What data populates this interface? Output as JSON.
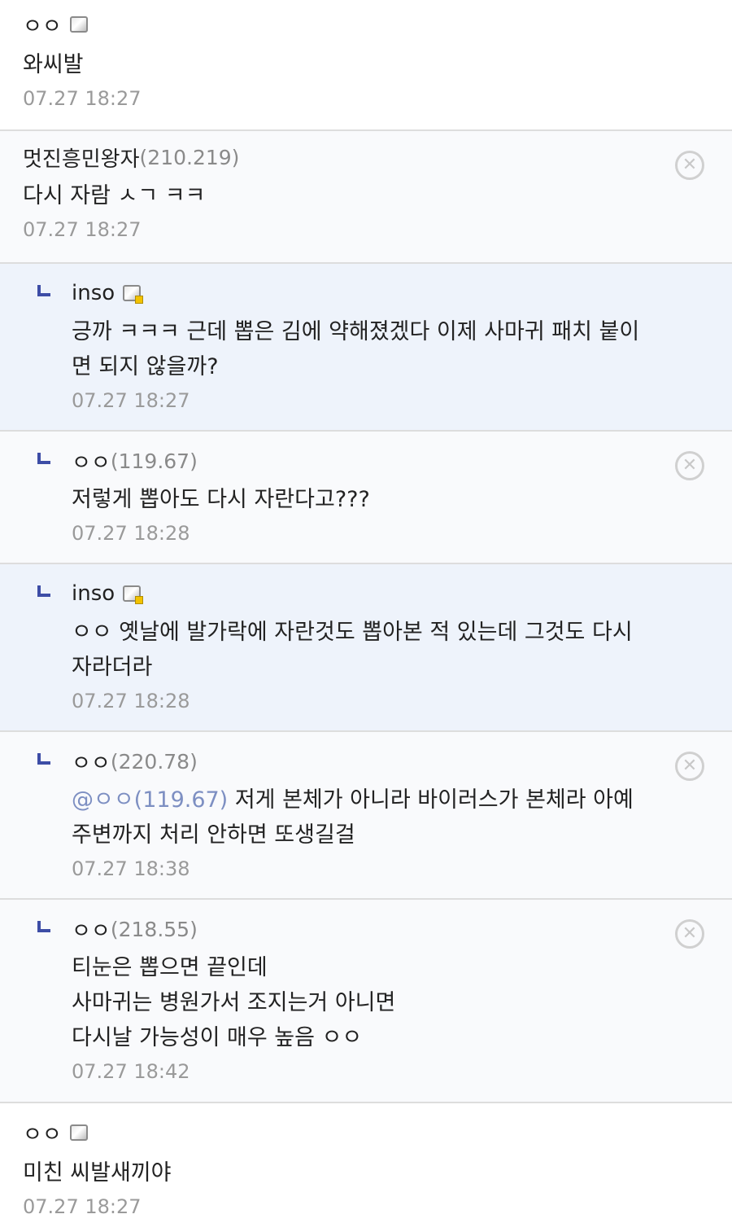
{
  "comments": [
    {
      "nick": "ㅇㅇ",
      "ip": "",
      "badge": true,
      "reply": false,
      "text": "와씨발",
      "time": "07.27 18:27"
    },
    {
      "nick": "멋진흥민왕자",
      "ip": "(210.219)",
      "badge": false,
      "reply": false,
      "text": "다시 자람 ㅅㄱ ㅋㅋ",
      "time": "07.27 18:27"
    },
    {
      "nick": "inso",
      "ip": "",
      "badge": true,
      "reply": true,
      "text": "긍까 ㅋㅋㅋ 근데 뽑은 김에 약해졌겠다 이제 사마귀 패치 붙이면 되지 않을까?",
      "time": "07.27 18:27"
    },
    {
      "nick": "ㅇㅇ",
      "ip": "(119.67)",
      "badge": false,
      "reply": true,
      "text": "저렇게 뽑아도 다시 자란다고???",
      "time": "07.27 18:28"
    },
    {
      "nick": "inso",
      "ip": "",
      "badge": true,
      "reply": true,
      "text": "ㅇㅇ 옛날에 발가락에 자란것도 뽑아본 적 있는데 그것도 다시 자라더라",
      "time": "07.27 18:28"
    },
    {
      "nick": "ㅇㅇ",
      "ip": "(220.78)",
      "badge": false,
      "reply": true,
      "mention": "@ㅇㅇ(119.67)",
      "text": " 저게 본체가 아니라 바이러스가 본체라 아예 주변까지 처리 안하면 또생길걸",
      "time": "07.27 18:38"
    },
    {
      "nick": "ㅇㅇ",
      "ip": "(218.55)",
      "badge": false,
      "reply": true,
      "text": "티눈은 뽑으면 끝인데\n사마귀는 병원가서 조지는거 아니면\n다시날 가능성이 매우 높음 ㅇㅇ",
      "time": "07.27 18:42"
    },
    {
      "nick": "ㅇㅇ",
      "ip": "",
      "badge": true,
      "reply": false,
      "text": "미친 씨발새끼야",
      "time": "07.27 18:27"
    }
  ],
  "icons": {
    "reply": "reply-arrow-icon",
    "delete": "close-circle-icon",
    "badge": "gallery-badge-icon"
  },
  "colors": {
    "reply_bg": "#eef3fb",
    "reply_arrow": "#3d4da6",
    "mention": "#7d8fc2",
    "time": "#9a9a9a"
  }
}
